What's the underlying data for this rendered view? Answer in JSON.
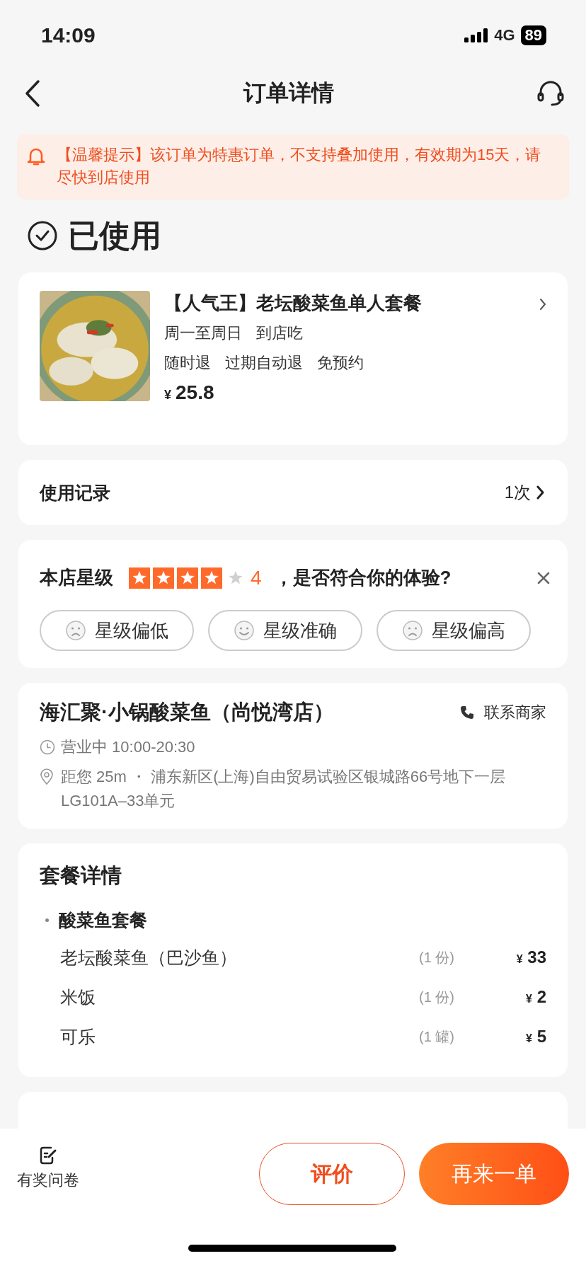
{
  "status_bar": {
    "time": "14:09",
    "network": "4G",
    "battery": "89"
  },
  "nav": {
    "title": "订单详情"
  },
  "notice": {
    "text": "【温馨提示】该订单为特惠订单，不支持叠加使用，有效期为15天，请尽快到店使用"
  },
  "status": {
    "text": "已使用"
  },
  "product": {
    "title": "【人气王】老坛酸菜鱼单人套餐",
    "lines": [
      [
        "周一至周日",
        "到店吃"
      ],
      [
        "随时退",
        "过期自动退",
        "免预约"
      ]
    ],
    "currency": "¥",
    "price": "25.8"
  },
  "usage": {
    "label": "使用记录",
    "count": "1次"
  },
  "rating": {
    "label": "本店星级",
    "stars": 4,
    "score": "4",
    "question": "，是否符合你的体验?",
    "options": [
      {
        "label": "星级偏低",
        "kind": "frown"
      },
      {
        "label": "星级准确",
        "kind": "smile"
      },
      {
        "label": "星级偏高",
        "kind": "frown"
      }
    ]
  },
  "store": {
    "name": "海汇聚·小锅酸菜鱼（尚悦湾店）",
    "contact": "联系商家",
    "hours": "营业中 10:00-20:30",
    "address": "距您 25m ・ 浦东新区(上海)自由贸易试验区银城路66号地下一层LG101A–33单元"
  },
  "package": {
    "title": "套餐详情",
    "group": "酸菜鱼套餐",
    "items": [
      {
        "name": "老坛酸菜鱼（巴沙鱼）",
        "qty": "(1 份)",
        "currency": "¥",
        "price": "33"
      },
      {
        "name": "米饭",
        "qty": "(1 份)",
        "currency": "¥",
        "price": "2"
      },
      {
        "name": "可乐",
        "qty": "(1 罐)",
        "currency": "¥",
        "price": "5"
      }
    ]
  },
  "bottom": {
    "survey": "有奖问卷",
    "buttons": [
      {
        "label": "评价",
        "kind": "outline"
      },
      {
        "label": "再来一单",
        "kind": "primary"
      }
    ]
  }
}
